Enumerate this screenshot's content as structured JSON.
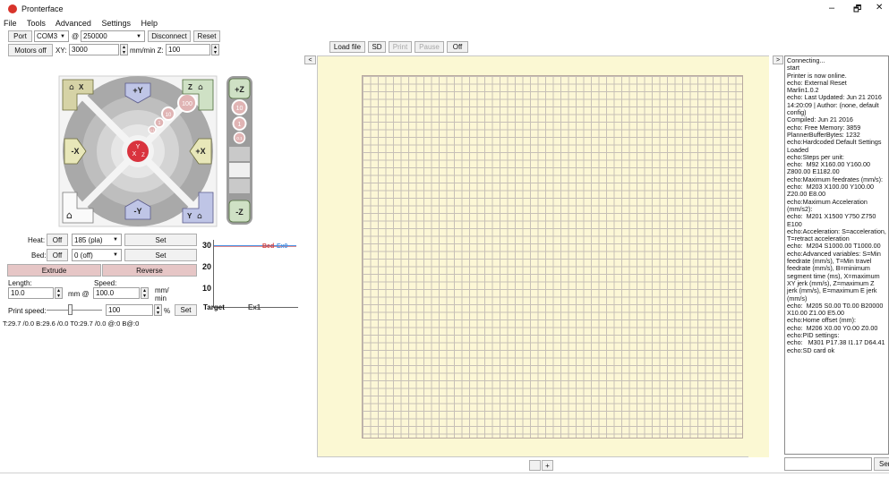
{
  "app": {
    "title": "Pronterface"
  },
  "window_controls": {
    "minimize": "–",
    "maximize": "🗗",
    "close": "✕"
  },
  "menu": [
    "File",
    "Tools",
    "Advanced",
    "Settings",
    "Help"
  ],
  "connection": {
    "port_label": "Port",
    "port_value": "COM3",
    "baud_at": "@",
    "baud_value": "250000",
    "disconnect": "Disconnect",
    "reset": "Reset"
  },
  "motors": {
    "motors_off": "Motors off",
    "xy_label": "XY:",
    "xy_value": "3000",
    "mm_min_z": "mm/min Z:",
    "z_value": "100"
  },
  "jog": {
    "home_x": "X",
    "home_z": "Z",
    "plus_y": "+Y",
    "minus_y": "-Y",
    "plus_x": "+X",
    "minus_x": "-X",
    "home_y": "Y",
    "center_y": "Y",
    "center_x": "X",
    "center_z": "Z",
    "dist_100": "100",
    "dist_10": "10",
    "dist_1": "1",
    "dist_01": "0.1",
    "z_plus": "+Z",
    "z_minus": "-Z",
    "z_10": "10",
    "z_1": "1",
    "z_01": "0.1"
  },
  "temps": {
    "heat_label": "Heat:",
    "heat_off": "Off",
    "heat_value": "185 (pla)",
    "heat_set": "Set",
    "bed_label": "Bed:",
    "bed_off": "Off",
    "bed_value": "0 (off)",
    "bed_set": "Set"
  },
  "extrude": {
    "extrude": "Extrude",
    "reverse": "Reverse",
    "length_label": "Length:",
    "speed_label": "Speed:",
    "length_value": "10.0",
    "mm_at": "mm @",
    "speed_value": "100.0",
    "mm_per": "mm/",
    "min": "min"
  },
  "print_speed": {
    "label": "Print speed:",
    "value": "100",
    "percent": "%",
    "set": "Set",
    "level": 0.42
  },
  "status_line": "T:29.7 /0.0 B:29.6 /0.0 T0:29.7 /0.0 @:0 B@:0",
  "graph": {
    "y30": "30",
    "y20": "20",
    "y10": "10",
    "bed": "Bed",
    "ex0": "Ex0",
    "target": "Target",
    "ex1": "Ex1"
  },
  "toolbar": {
    "collapse": "<",
    "load_file": "Load file",
    "sd": "SD",
    "print": "Print",
    "pause": "Pause",
    "off": "Off"
  },
  "view_controls": {
    "minus": "",
    "plus": "+"
  },
  "log": {
    "toggle": ">",
    "lines": [
      "Connecting...",
      "start",
      "Printer is now online.",
      "echo: External Reset",
      "Marlin1.0.2",
      "echo: Last Updated: Jun 21 2016 14:20:09 | Author: (none, default config)",
      "Compiled: Jun 21 2016",
      "echo: Free Memory: 3859",
      "PlannerBufferBytes: 1232",
      "echo:Hardcoded Default Settings Loaded",
      "echo:Steps per unit:",
      "echo:  M92 X160.00 Y160.00 Z800.00 E1182.00",
      "echo:Maximum feedrates (mm/s):",
      "echo:  M203 X100.00 Y100.00 Z20.00 E8.00",
      "echo:Maximum Acceleration (mm/s2):",
      "echo:  M201 X1500 Y750 Z750 E100",
      "echo:Acceleration: S=acceleration, T=retract acceleration",
      "echo:  M204 S1000.00 T1000.00",
      "echo:Advanced variables: S=Min feedrate (mm/s), T=Min travel feedrate (mm/s), B=minimum segment time (ms), X=maximum XY jerk (mm/s), Z=maximum Z jerk (mm/s), E=maximum E jerk (mm/s)",
      "echo:  M205 S0.00 T0.00 B20000 X10.00 Z1.00 E5.00",
      "echo:Home offset (mm):",
      "echo:  M206 X0.00 Y0.00 Z0.00",
      "echo:PID settings:",
      "echo:   M301 P17.38 I1.17 D64.41",
      "echo:SD card ok"
    ],
    "command_placeholder": "",
    "send": "Send"
  }
}
